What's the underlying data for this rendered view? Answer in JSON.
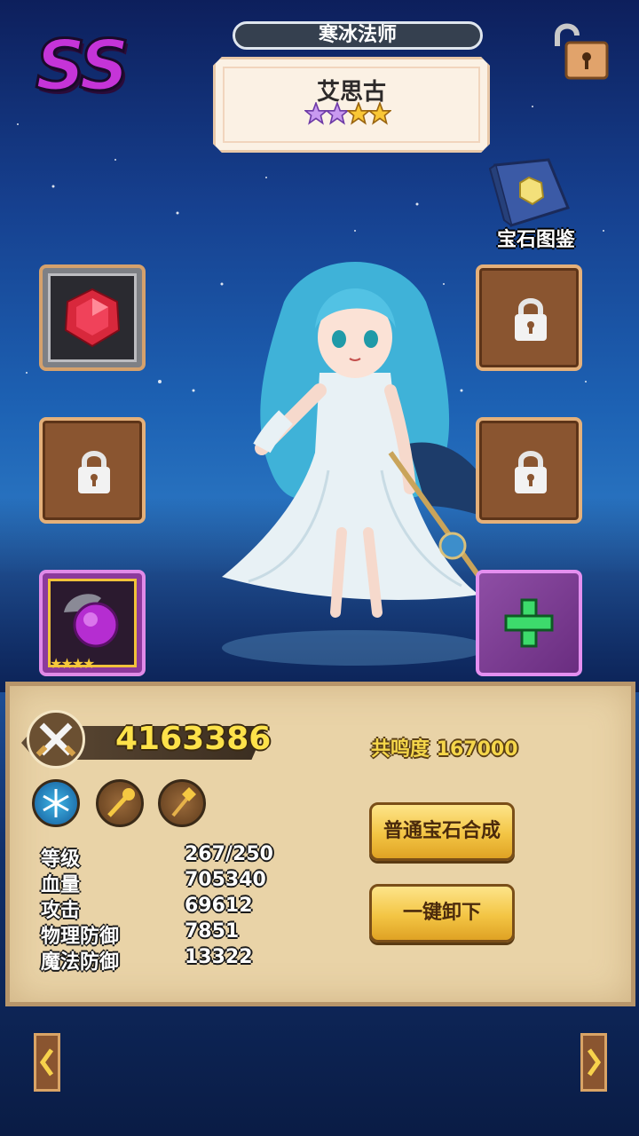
{
  "header": {
    "rank": "SS",
    "class_name": "寒冰法师",
    "hero_name": "艾思古",
    "stars": {
      "purple": 2,
      "gold": 2
    }
  },
  "gem_book": {
    "label": "宝石图鉴",
    "icon": "gem-book-icon"
  },
  "top_lock": {
    "icon": "unlocked-padlock-icon"
  },
  "slots": {
    "left": [
      {
        "state": "equipped",
        "icon": "red-gem-icon"
      },
      {
        "state": "locked",
        "icon": "padlock-icon"
      },
      {
        "state": "equipped",
        "icon": "purple-gem-dragon-icon",
        "stars": 4
      }
    ],
    "right": [
      {
        "state": "locked",
        "icon": "padlock-icon"
      },
      {
        "state": "locked",
        "icon": "padlock-icon"
      },
      {
        "state": "add",
        "icon": "green-plus-icon"
      }
    ]
  },
  "panel": {
    "power": "4163386",
    "resonance": "共鸣度 167000",
    "skills": [
      "ice-snowflake-skill-icon",
      "golden-staff-skill-icon",
      "scepter-skill-icon"
    ],
    "stats": [
      {
        "label": "等级",
        "value": "267/250"
      },
      {
        "label": "血量",
        "value": "705340"
      },
      {
        "label": "攻击",
        "value": "69612"
      },
      {
        "label": "物理防御",
        "value": "7851"
      },
      {
        "label": "魔法防御",
        "value": "13322"
      }
    ],
    "buttons": {
      "synthesize": "普通宝石合成",
      "unequip_all": "一键卸下"
    }
  },
  "nav": {
    "prev": "‹",
    "next": "›"
  },
  "colors": {
    "rank": "#c534d8",
    "power": "#fde24a",
    "panel": "#e9d3a7",
    "button": "#f3c544"
  }
}
